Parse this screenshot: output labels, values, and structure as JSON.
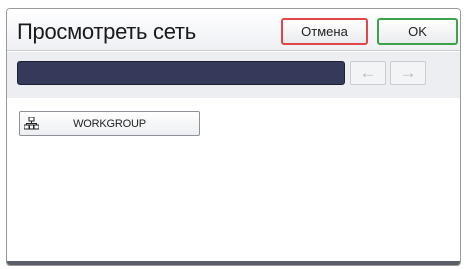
{
  "header": {
    "title": "Просмотреть сеть",
    "cancel_label": "Отмена",
    "ok_label": "OK"
  },
  "toolbar": {
    "path_value": "",
    "prev_arrow": "←",
    "next_arrow": "→"
  },
  "list": {
    "items": [
      {
        "label": "WORKGROUP",
        "icon": "network-workgroup-icon"
      }
    ]
  },
  "colors": {
    "cancel_border": "#e04646",
    "ok_border": "#3da34b",
    "path_bar": "#363a5a"
  }
}
